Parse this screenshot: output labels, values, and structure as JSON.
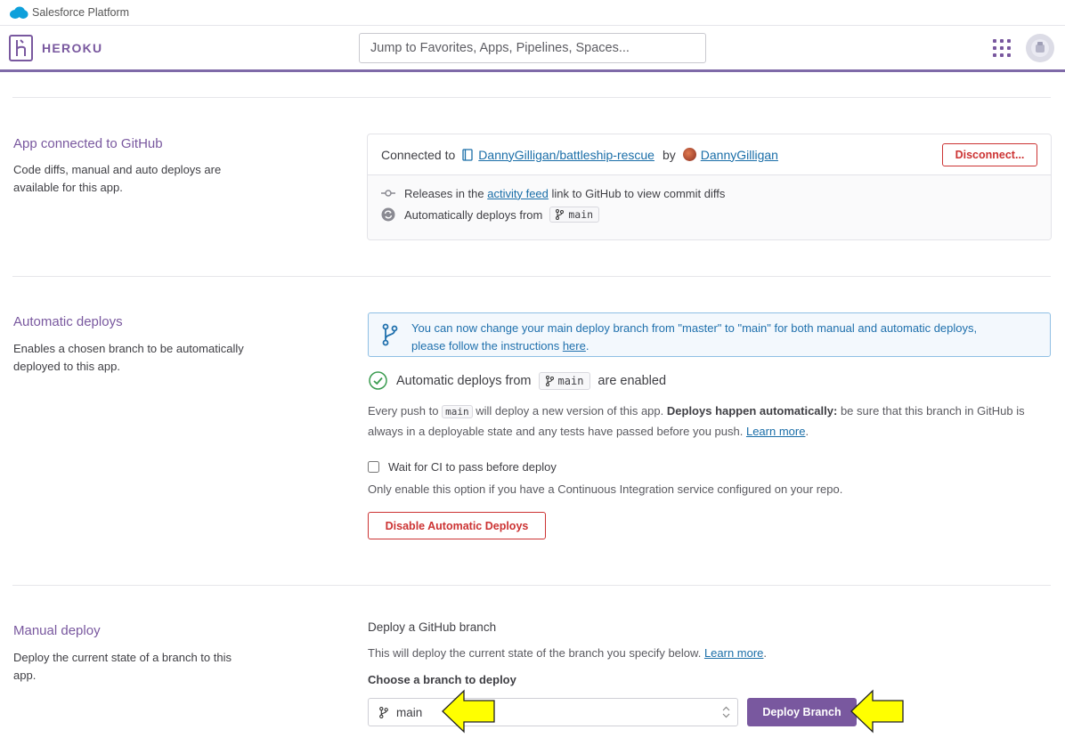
{
  "salesforce": {
    "title": "Salesforce Platform"
  },
  "header": {
    "brand": "HEROKU",
    "search_placeholder": "Jump to Favorites, Apps, Pipelines, Spaces..."
  },
  "github_section": {
    "title": "App connected to GitHub",
    "description": "Code diffs, manual and auto deploys are available for this app.",
    "connected_prefix": "Connected to",
    "repo": "DannyGilligan/battleship-rescue",
    "by": "by",
    "user": "DannyGilligan",
    "disconnect_label": "Disconnect...",
    "releases_pre": "Releases in the",
    "releases_link": "activity feed",
    "releases_post": "link to GitHub to view commit diffs",
    "auto_from": "Automatically deploys from",
    "branch": "main"
  },
  "auto_section": {
    "title": "Automatic deploys",
    "description": "Enables a chosen branch to be automatically deployed to this app.",
    "banner_line1": "You can now change your main deploy branch from \"master\" to \"main\" for both manual and automatic deploys,",
    "banner_line2_pre": "please follow the instructions",
    "banner_link": "here",
    "banner_line2_post": ".",
    "enabled_pre": "Automatic deploys from",
    "enabled_branch": "main",
    "enabled_post": "are enabled",
    "push_pre": "Every push to",
    "push_branch": "main",
    "push_mid": "will deploy a new version of this app.",
    "push_bold": "Deploys happen automatically:",
    "push_post": "be sure that this branch in GitHub is",
    "push_line2": "always in a deployable state and any tests have passed before you push.",
    "learn_more": "Learn more",
    "period": ".",
    "ci_label": "Wait for CI to pass before deploy",
    "ci_checked": false,
    "ci_help": "Only enable this option if you have a Continuous Integration service configured on your repo.",
    "disable_label": "Disable Automatic Deploys"
  },
  "manual_section": {
    "title": "Manual deploy",
    "description": "Deploy the current state of a branch to this app.",
    "heading": "Deploy a GitHub branch",
    "help_pre": "This will deploy the current state of the branch you specify below.",
    "learn_more": "Learn more",
    "period": ".",
    "choose_label": "Choose a branch to deploy",
    "selected_branch": "main",
    "deploy_label": "Deploy Branch"
  },
  "colors": {
    "brand_purple": "#79589f",
    "danger_red": "#cc3333",
    "link_blue": "#1a6ea8",
    "info_blue": "#1f70ad",
    "success_green": "#3a9b4f",
    "highlight_yellow": "#ffff00"
  }
}
